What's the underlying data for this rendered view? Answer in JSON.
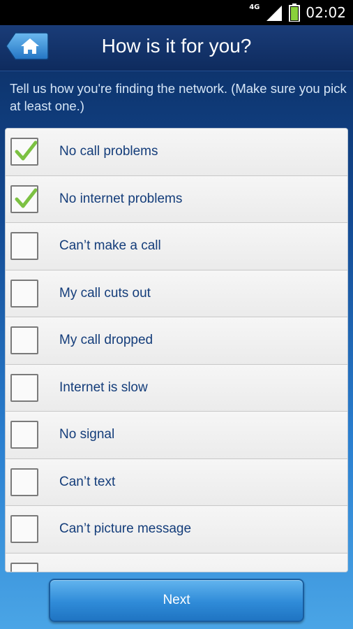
{
  "status_bar": {
    "network": "4G",
    "time": "02:02"
  },
  "header": {
    "title": "How is it for you?",
    "home_icon": "home-icon"
  },
  "instructions": "Tell us how you're finding the network. (Make sure you pick at least one.)",
  "options": [
    {
      "label": "No call problems",
      "checked": true
    },
    {
      "label": "No internet problems",
      "checked": true
    },
    {
      "label": "Can’t make a call",
      "checked": false
    },
    {
      "label": "My call cuts out",
      "checked": false
    },
    {
      "label": "My call dropped",
      "checked": false
    },
    {
      "label": "Internet is slow",
      "checked": false
    },
    {
      "label": "No signal",
      "checked": false
    },
    {
      "label": "Can’t text",
      "checked": false
    },
    {
      "label": "Can’t picture message",
      "checked": false
    },
    {
      "label": "",
      "checked": false
    }
  ],
  "footer": {
    "next_label": "Next"
  },
  "colors": {
    "check": "#7cc142",
    "label_text": "#143d7a",
    "button": "#2f8bd8"
  }
}
